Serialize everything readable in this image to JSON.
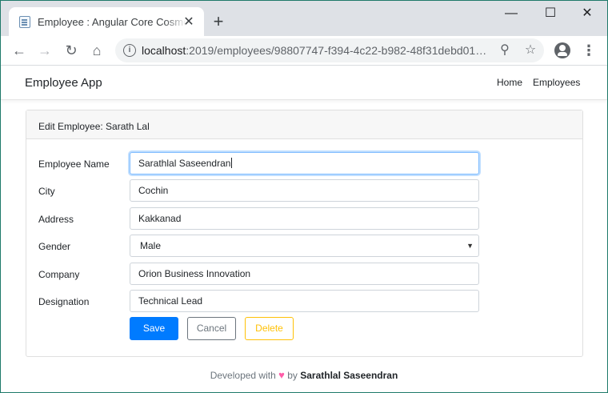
{
  "browser": {
    "tab_title": "Employee : Angular Core Cosmos",
    "tab_close": "✕",
    "new_tab": "+",
    "url_host": "localhost",
    "url_rest": ":2019/employees/98807747-f394-4c22-b982-48f31debd01…",
    "window_minimize": "—",
    "window_maximize": "☐",
    "window_close": "✕"
  },
  "navbar": {
    "brand": "Employee App",
    "links": [
      "Home",
      "Employees"
    ]
  },
  "card": {
    "title": "Edit Employee: Sarath Lal",
    "fields": [
      {
        "label": "Employee Name",
        "value": "Sarathlal Saseendran"
      },
      {
        "label": "City",
        "value": "Cochin"
      },
      {
        "label": "Address",
        "value": "Kakkanad"
      },
      {
        "label": "Gender",
        "value": "Male"
      },
      {
        "label": "Company",
        "value": "Orion Business Innovation"
      },
      {
        "label": "Designation",
        "value": "Technical Lead"
      }
    ],
    "buttons": {
      "save": "Save",
      "cancel": "Cancel",
      "delete": "Delete"
    }
  },
  "footer": {
    "prefix": "Developed with",
    "heart": "♥",
    "by": "by",
    "author": "Sarathlal Saseendran"
  },
  "colors": {
    "primary": "#007bff",
    "secondary": "#6c757d",
    "warning": "#ffc107",
    "heart": "#ff5ca8"
  }
}
